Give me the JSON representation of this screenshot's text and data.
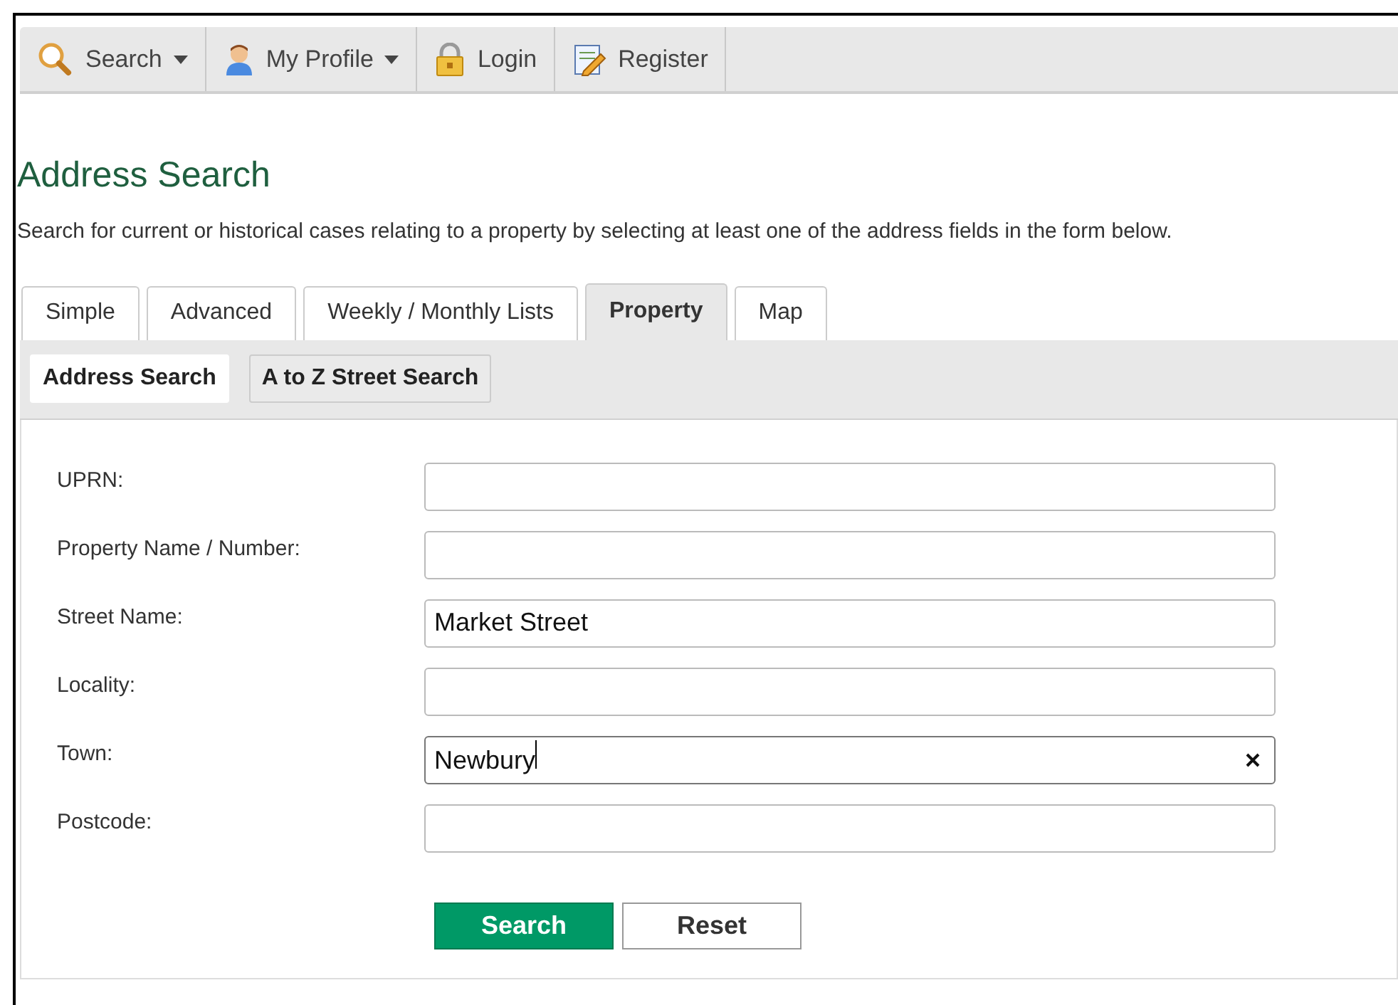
{
  "toolbar": [
    {
      "label": "Search",
      "dropdown": true
    },
    {
      "label": "My Profile",
      "dropdown": true
    },
    {
      "label": "Login",
      "dropdown": false
    },
    {
      "label": "Register",
      "dropdown": false
    }
  ],
  "heading": "Address Search",
  "description": "Search for current or historical cases relating to a property by selecting at least one of the address fields in the form below.",
  "tabs": [
    {
      "label": "Simple",
      "selected": false
    },
    {
      "label": "Advanced",
      "selected": false
    },
    {
      "label": "Weekly / Monthly Lists",
      "selected": false
    },
    {
      "label": "Property",
      "selected": true
    },
    {
      "label": "Map",
      "selected": false
    }
  ],
  "subtabs": [
    {
      "label": "Address Search",
      "selected": true
    },
    {
      "label": "A to Z Street Search",
      "selected": false
    }
  ],
  "fields": [
    {
      "label": "UPRN:",
      "focused": false
    },
    {
      "label": "Property Name / Number:",
      "focused": false
    },
    {
      "label": "Street Name:",
      "value": "Market Street",
      "focused": false
    },
    {
      "label": "Locality:",
      "focused": false
    },
    {
      "label": "Town:",
      "value": "Newbury",
      "focused": true
    },
    {
      "label": "Postcode:",
      "focused": false
    }
  ],
  "buttons": [
    {
      "label": "Search",
      "kind": "primary"
    },
    {
      "label": "Reset",
      "kind": "secondary"
    }
  ]
}
